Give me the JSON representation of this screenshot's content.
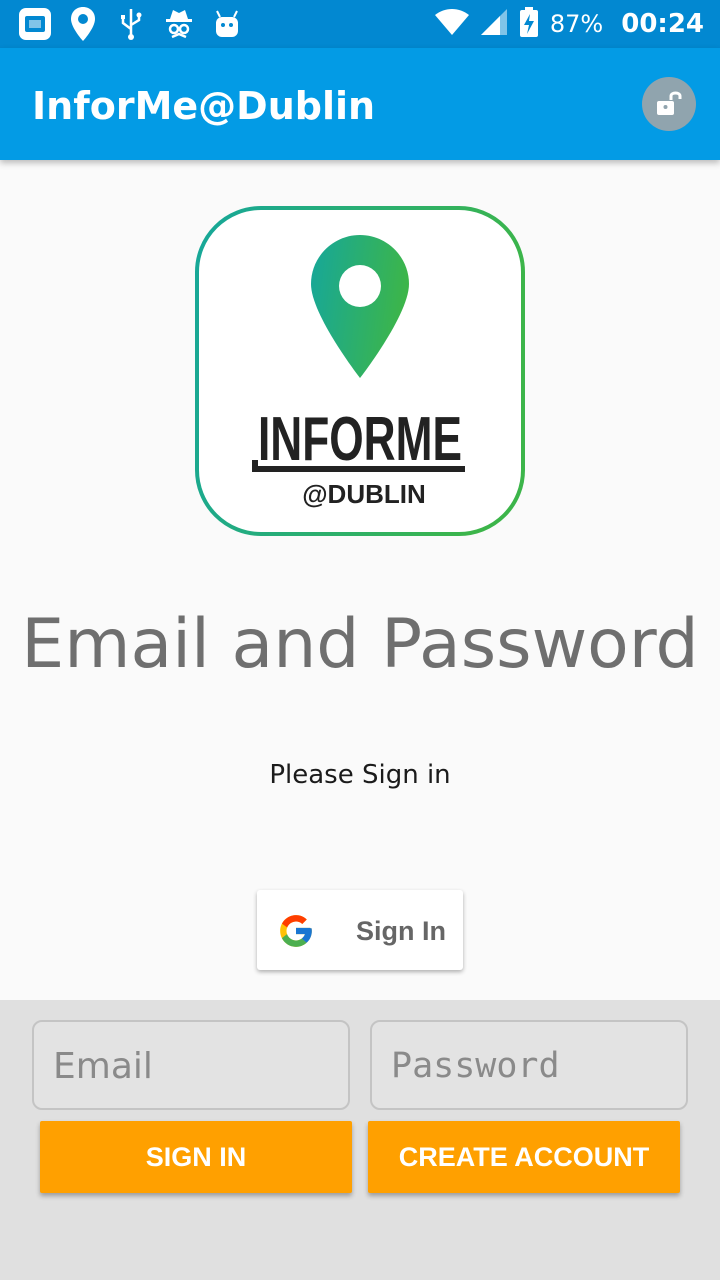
{
  "status_bar": {
    "battery_percent": "87%",
    "time": "00:24"
  },
  "app_bar": {
    "title": "InforMe@Dublin"
  },
  "logo": {
    "wordmark": "INFORME",
    "subtitle": "@DUBLIN",
    "colors": {
      "teal": "#16a79a",
      "green": "#3cb54a",
      "dark": "#222222"
    }
  },
  "main": {
    "heading": "Email and Password",
    "prompt": "Please Sign in",
    "google_button_label": "Sign In"
  },
  "form": {
    "email_placeholder": "Email",
    "password_placeholder": "Password",
    "sign_in_label": "SIGN IN",
    "create_account_label": "CREATE ACCOUNT"
  },
  "colors": {
    "status_bar": "#0288d1",
    "app_bar": "#039be5",
    "accent_button": "#ffa000"
  }
}
